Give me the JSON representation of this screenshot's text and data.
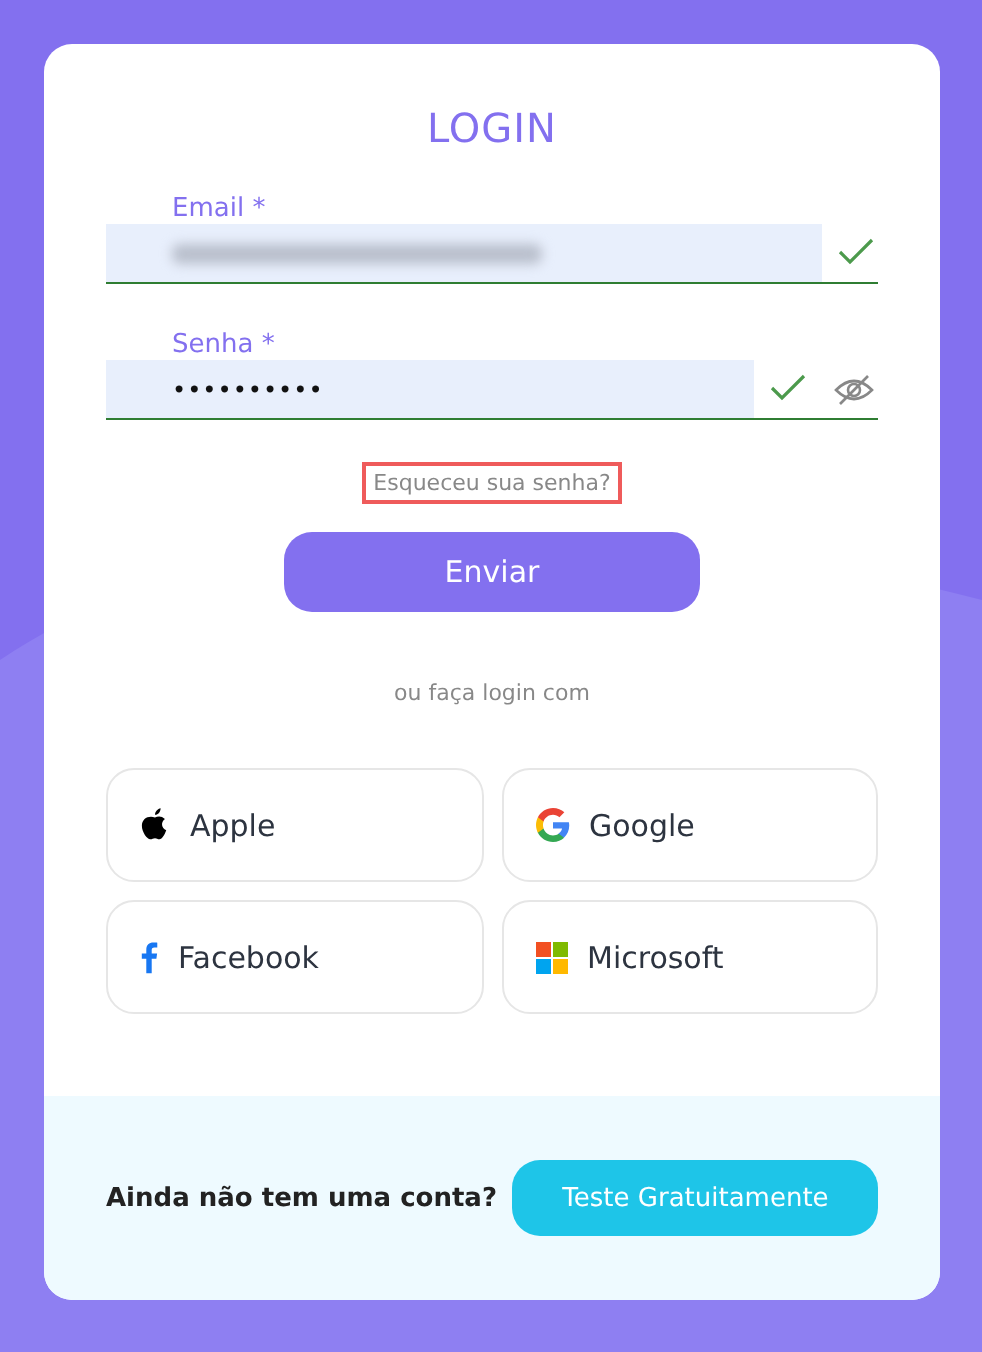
{
  "title": "LOGIN",
  "fields": [
    {
      "kind": "email",
      "label": "Email *",
      "value_redacted": true,
      "valid": true
    },
    {
      "kind": "password",
      "label": "Senha *",
      "value": "••••••••••",
      "valid": true,
      "reveal_toggle": true
    }
  ],
  "forgot_link": {
    "label": "Esqueceu sua senha?",
    "highlighted": true
  },
  "submit_button": "Enviar",
  "divider_text": "ou faça login com",
  "social_buttons": [
    {
      "kind": "apple",
      "label": "Apple"
    },
    {
      "kind": "google",
      "label": "Google"
    },
    {
      "kind": "facebook",
      "label": "Facebook"
    },
    {
      "kind": "microsoft",
      "label": "Microsoft"
    }
  ],
  "footer": {
    "prompt": "Ainda não tem uma conta?",
    "button": "Teste Gratuitamente"
  }
}
